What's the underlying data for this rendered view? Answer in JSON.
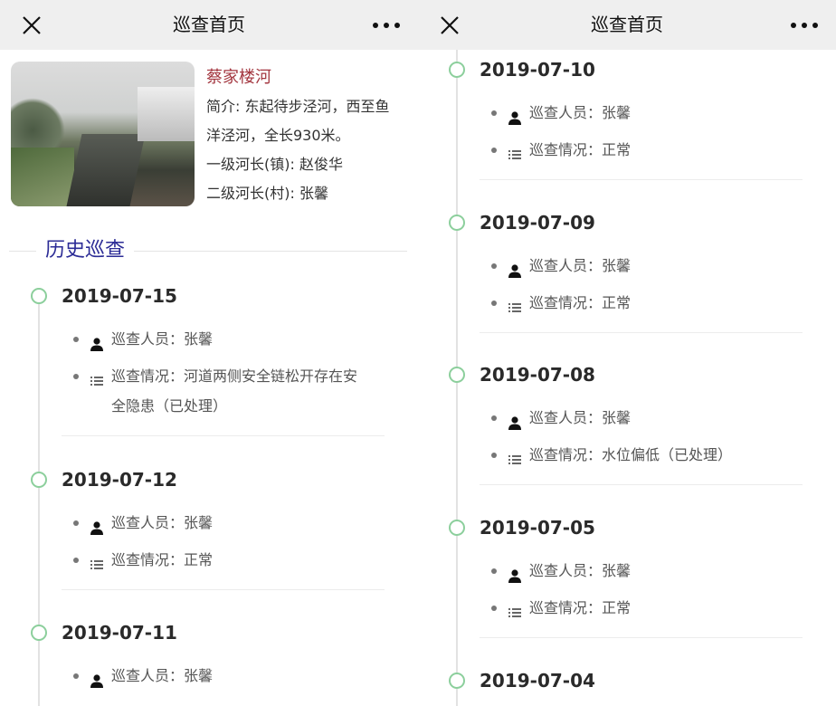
{
  "header": {
    "title": "巡查首页",
    "close_icon": "close-icon",
    "more_icon": "more-dots-icon"
  },
  "river": {
    "name": "蔡家楼河",
    "intro_line1": "简介: 东起待步泾河，西至鱼",
    "intro_line2": "洋泾河，全长930米。",
    "chief_town": "一级河长(镇): 赵俊华",
    "chief_village": "二级河长(村): 张馨"
  },
  "history": {
    "title": "历史巡查",
    "inspector_label": "巡查人员：",
    "status_label": "巡查情况：",
    "accent_color": "#8ccf9c"
  },
  "left_records": [
    {
      "date": "2019-07-15",
      "inspector": "张馨",
      "status": "河道两侧安全链松开存在安全隐患（已处理）"
    },
    {
      "date": "2019-07-12",
      "inspector": "张馨",
      "status": "正常"
    },
    {
      "date": "2019-07-11",
      "inspector": "张馨"
    }
  ],
  "right_records": [
    {
      "date": "2019-07-10",
      "inspector": "张馨",
      "status": "正常"
    },
    {
      "date": "2019-07-09",
      "inspector": "张馨",
      "status": "正常"
    },
    {
      "date": "2019-07-08",
      "inspector": "张馨",
      "status": "水位偏低（已处理）"
    },
    {
      "date": "2019-07-05",
      "inspector": "张馨",
      "status": "正常"
    },
    {
      "date": "2019-07-04"
    }
  ]
}
